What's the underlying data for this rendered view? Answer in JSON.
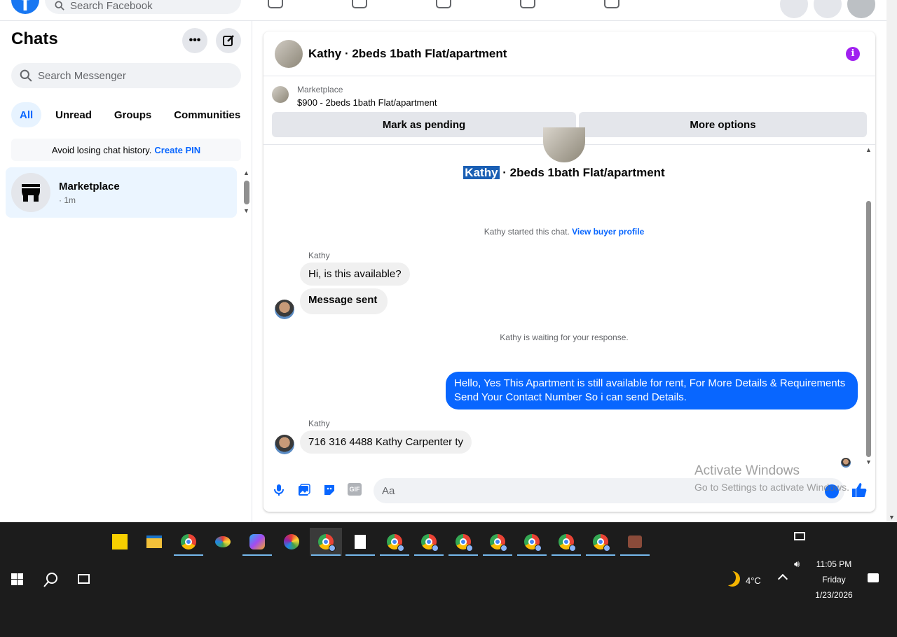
{
  "topbar": {
    "search_placeholder": "Search Facebook"
  },
  "sidebar": {
    "title": "Chats",
    "search_placeholder": "Search Messenger",
    "filters": [
      "All",
      "Unread",
      "Groups",
      "Communities"
    ],
    "pin_text": "Avoid losing chat history.",
    "pin_link": "Create PIN",
    "chat": {
      "name": "Marketplace",
      "time": "· 1m"
    }
  },
  "conversation": {
    "header_title": "Kathy · 2beds 1bath Flat/apartment",
    "marketplace_label": "Marketplace",
    "listing": "$900 - 2beds 1bath Flat/apartment",
    "btn_pending": "Mark as pending",
    "btn_more": "More options",
    "title_name": "Kathy",
    "title_rest": "· 2beds 1bath Flat/apartment",
    "started_text": "Kathy started this chat.",
    "view_profile": "View buyer profile",
    "sender1": "Kathy",
    "msg1": "Hi, is this available?",
    "msg2": "Message sent",
    "waiting": "Kathy is waiting for your response.",
    "outgoing": "Hello, Yes This Apartment is still available for rent, For More Details & Requirements Send Your Contact Number So i can send Details.",
    "sender2": "Kathy",
    "msg3": "716 316 4488 Kathy Carpenter ty",
    "composer_placeholder": "Aa",
    "gif_label": "GIF"
  },
  "watermark": {
    "line1": "Activate Windows",
    "line2": "Go to Settings to activate Windows."
  },
  "taskbar": {
    "weather": "4°C",
    "time": "11:05 PM",
    "day": "Friday",
    "date": "1/23/2026"
  },
  "colors": {
    "accent": "#0866ff",
    "facebook_blue": "#1877f2",
    "taskbar": "#1c1c1c"
  }
}
